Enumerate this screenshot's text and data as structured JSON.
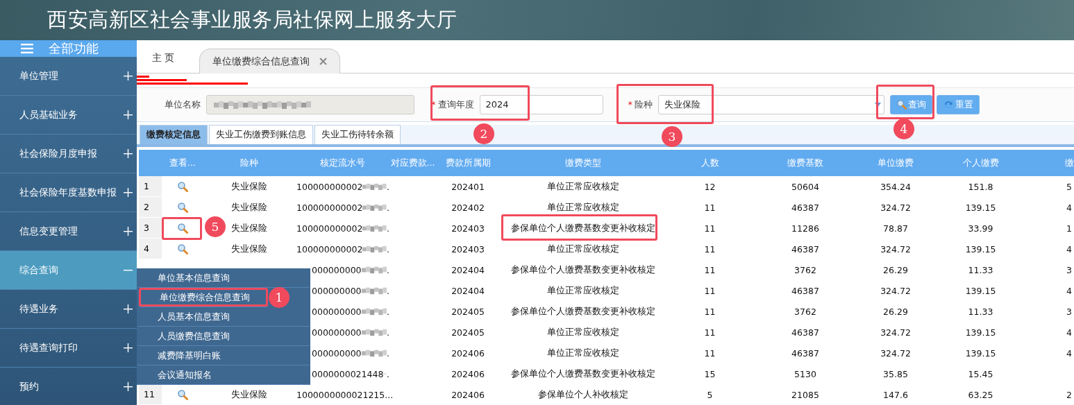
{
  "header": {
    "title": "西安高新区社会事业服务局社保网上服务大厅"
  },
  "sidebar": {
    "menu_button": {
      "label": "全部功能"
    },
    "items": [
      {
        "label": "单位管理",
        "expanded": false
      },
      {
        "label": "人员基础业务",
        "expanded": false
      },
      {
        "label": "社会保险月度申报",
        "expanded": false
      },
      {
        "label": "社会保险年度基数申报",
        "expanded": false
      },
      {
        "label": "信息变更管理",
        "expanded": false
      },
      {
        "label": "综合查询",
        "expanded": true
      },
      {
        "label": "待遇业务",
        "expanded": false
      },
      {
        "label": "待遇查询打印",
        "expanded": false
      },
      {
        "label": "预约",
        "expanded": false
      }
    ],
    "submenu": [
      {
        "label": "单位基本信息查询",
        "highlighted": false
      },
      {
        "label": "单位缴费综合信息查询",
        "highlighted": true
      },
      {
        "label": "人员基本信息查询",
        "highlighted": false
      },
      {
        "label": "人员缴费信息查询",
        "highlighted": false
      },
      {
        "label": "减费降基明白账",
        "highlighted": false
      },
      {
        "label": "会议通知报名",
        "highlighted": false
      }
    ]
  },
  "page_tabs": [
    {
      "label": "主 页",
      "selected": false,
      "closable": false
    },
    {
      "label": "单位缴费综合信息查询",
      "selected": true,
      "closable": true
    }
  ],
  "form": {
    "fields": [
      {
        "kind": "blurred",
        "label": "单位名称"
      },
      {
        "kind": "text",
        "label": "查询年度",
        "required_mark": "*",
        "value": "2024"
      },
      {
        "kind": "select",
        "label": "险种",
        "required_mark": "*",
        "value": "失业保险"
      }
    ],
    "buttons": [
      {
        "kind": "search",
        "label": "查询"
      },
      {
        "kind": "reset",
        "label": "重置"
      }
    ]
  },
  "sub_tabs": [
    {
      "label": "缴费核定信息",
      "selected": true
    },
    {
      "label": "失业工伤缴费到账信息",
      "selected": false
    },
    {
      "label": "失业工伤待转余额",
      "selected": false
    }
  ],
  "table": {
    "columns": [
      "查看...",
      "险种",
      "核定流水号",
      "对应费款...",
      "费款所属期",
      "缴费类型",
      "人数",
      "缴费基数",
      "单位缴费",
      "个人缴费",
      "缴"
    ],
    "rows": [
      {
        "index": "1",
        "view": true,
        "insurance": "失业保险",
        "serial": "100000000002",
        "serial_blurred": true,
        "serial_end": ".",
        "period": "202401",
        "type": "单位正常应收核定",
        "count": "12",
        "base": "50604",
        "unit_fee": "354.24",
        "personal_fee": "151.8",
        "column_11": "5"
      },
      {
        "index": "2",
        "view": true,
        "insurance": "失业保险",
        "serial": "100000000002",
        "serial_blurred": true,
        "serial_end": ".",
        "period": "202402",
        "type": "单位正常应收核定",
        "count": "11",
        "base": "46387",
        "unit_fee": "324.72",
        "personal_fee": "139.15",
        "column_11": "4"
      },
      {
        "index": "3",
        "view": true,
        "insurance": "失业保险",
        "serial": "100000000002",
        "serial_blurred": true,
        "serial_end": ".",
        "period": "202403",
        "type": "参保单位个人缴费基数变更补收核定",
        "count": "11",
        "base": "11286",
        "unit_fee": "78.87",
        "personal_fee": "33.99",
        "column_11": "1"
      },
      {
        "index": "4",
        "view": true,
        "insurance": "失业保险",
        "serial": "100000000002",
        "serial_blurred": true,
        "serial_end": ".",
        "period": "202403",
        "type": "单位正常应收核定",
        "count": "11",
        "base": "46387",
        "unit_fee": "324.72",
        "personal_fee": "139.15",
        "column_11": "4"
      },
      {
        "view": false,
        "kind": "partly_hidden",
        "serial": "000000000",
        "serial_blurred": true,
        "serial_end": ".",
        "period": "202404",
        "type": "参保单位个人缴费基数变更补收核定",
        "count": "11",
        "base": "3762",
        "unit_fee": "26.29",
        "personal_fee": "11.33",
        "column_11": "3"
      },
      {
        "view": false,
        "kind": "partly_hidden",
        "serial": "000000000",
        "serial_blurred": true,
        "serial_end": ".",
        "period": "202404",
        "type": "单位正常应收核定",
        "count": "11",
        "base": "46387",
        "unit_fee": "324.72",
        "personal_fee": "139.15",
        "column_11": "4"
      },
      {
        "view": false,
        "kind": "partly_hidden",
        "serial": "000000000",
        "serial_blurred": true,
        "serial_end": ".",
        "period": "202405",
        "type": "参保单位个人缴费基数变更补收核定",
        "count": "11",
        "base": "3762",
        "unit_fee": "26.29",
        "personal_fee": "11.33",
        "column_11": "3"
      },
      {
        "view": false,
        "kind": "partly_hidden",
        "serial": "000000000",
        "serial_blurred": true,
        "serial_end": ".",
        "period": "202405",
        "type": "单位正常应收核定",
        "count": "11",
        "base": "46387",
        "unit_fee": "324.72",
        "personal_fee": "139.15",
        "column_11": "4"
      },
      {
        "view": false,
        "kind": "partly_hidden",
        "serial": "000000000",
        "serial_blurred": true,
        "serial_end": ".",
        "period": "202406",
        "type": "单位正常应收核定",
        "count": "11",
        "base": "46387",
        "unit_fee": "324.72",
        "personal_fee": "139.15",
        "column_11": "4"
      },
      {
        "view": false,
        "kind": "partly_hidden",
        "serial": "0000000021448",
        "serial_blurred": true,
        "serial_end": ".",
        "period": "202406",
        "type": "参保单位个人缴费基数变更补收核定",
        "count": "15",
        "base": "5130",
        "unit_fee": "35.85",
        "personal_fee": "15.45"
      },
      {
        "index": "11",
        "view": true,
        "insurance": "失业保险",
        "serial": "1000000000021215...",
        "serial_blurred": false,
        "period": "202406",
        "type": "参保单位个人补收核定",
        "count": "5",
        "base": "21085",
        "unit_fee": "147.6",
        "personal_fee": "63.25",
        "column_11": "2"
      }
    ]
  },
  "annotations": [
    {
      "kind": "badge",
      "number": "1"
    },
    {
      "kind": "numbered",
      "number": "2"
    },
    {
      "kind": "numbered",
      "number": "3"
    },
    {
      "kind": "numbered",
      "number": "4"
    },
    {
      "kind": "numbered",
      "number": "5"
    },
    {
      "kind": "box"
    }
  ]
}
